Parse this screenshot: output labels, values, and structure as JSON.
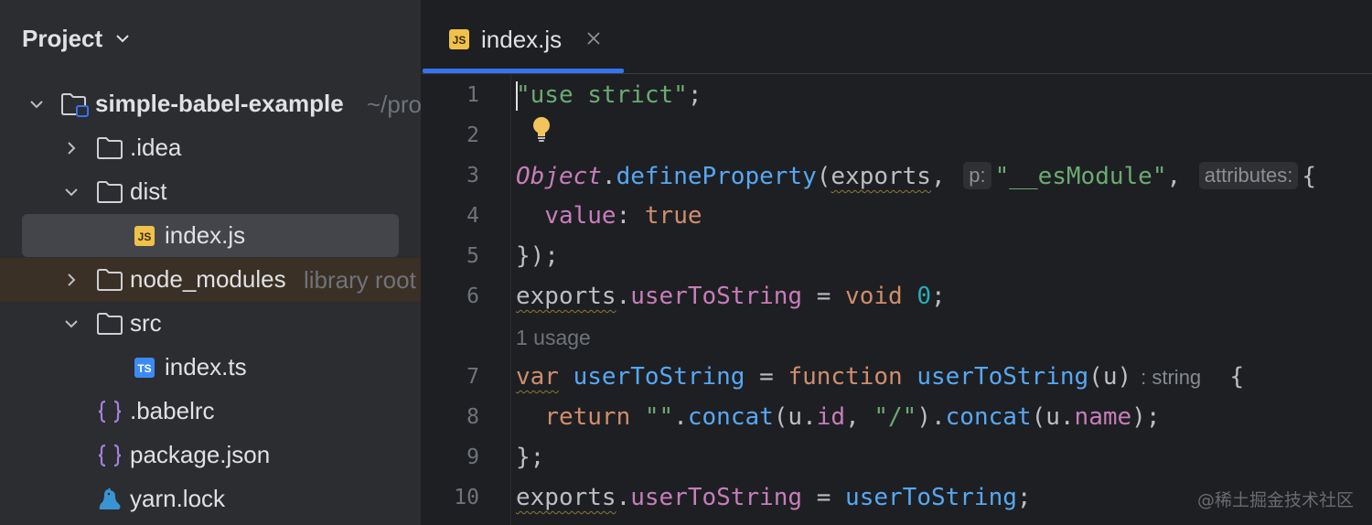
{
  "project_panel": {
    "title": "Project",
    "tree": [
      {
        "name": "simple-babel-example",
        "hint": "~/pro",
        "kind": "project-folder",
        "expanded": true
      },
      {
        "name": ".idea",
        "kind": "folder",
        "expanded": false
      },
      {
        "name": "dist",
        "kind": "folder",
        "expanded": true
      },
      {
        "name": "index.js",
        "kind": "js-file",
        "selected": true
      },
      {
        "name": "node_modules",
        "hint": "library root",
        "kind": "folder",
        "expanded": false
      },
      {
        "name": "src",
        "kind": "folder",
        "expanded": true
      },
      {
        "name": "index.ts",
        "kind": "ts-file"
      },
      {
        "name": ".babelrc",
        "kind": "json-file"
      },
      {
        "name": "package.json",
        "kind": "json-file"
      },
      {
        "name": "yarn.lock",
        "kind": "yarn-file"
      }
    ]
  },
  "editor": {
    "tab": {
      "label": "index.js",
      "icon": "js-file-icon",
      "active": true
    },
    "line_numbers": [
      "1",
      "2",
      "3",
      "4",
      "5",
      "6",
      "7",
      "8",
      "9",
      "10"
    ],
    "codelens_usage": "1 usage",
    "inlay_hints": {
      "p": "p:",
      "attributes": "attributes:",
      "return_type": ": string"
    },
    "lines": {
      "l1": {
        "string": "\"use strict\"",
        "end": ";"
      },
      "l3": {
        "obj": "Object",
        "dot": ".",
        "fn": "defineProperty",
        "open": "(",
        "arg1": "exports",
        "comma1": ",",
        "arg2": "\"__esModule\"",
        "comma2": ",",
        "brace": "{"
      },
      "l4": {
        "indent": "  ",
        "prop": "value",
        "colon": ": ",
        "val": "true"
      },
      "l5": {
        "text": "});"
      },
      "l6": {
        "ref": "exports",
        "dot": ".",
        "prop": "userToString",
        "eq": " = ",
        "kw": "void",
        "sp": " ",
        "num": "0",
        "end": ";"
      },
      "l7": {
        "kw": "var",
        "sp1": " ",
        "name": "userToString",
        "eq": " = ",
        "fnkw": "function",
        "sp2": " ",
        "fname": "userToString",
        "param": "(u)",
        "brace": "  {"
      },
      "l8": {
        "indent": "  ",
        "kw": "return",
        "sp": " ",
        "str1": "\"\"",
        "dot1": ".",
        "m1": "concat",
        "open1": "(u.",
        "id": "id",
        "comma": ", ",
        "str2": "\"/\"",
        "close1": ").",
        "m2": "concat",
        "open2": "(u.",
        "nameprop": "name",
        "close2": ");"
      },
      "l9": {
        "text": "};"
      },
      "l10": {
        "ref": "exports",
        "dot": ".",
        "prop": "userToString",
        "eq": " = ",
        "fn": "userToString",
        "end": ";"
      }
    }
  },
  "watermark": "@稀土掘金技术社区",
  "colors": {
    "keyword": "#cf8e6d",
    "string": "#6aab73",
    "function": "#56a8f5",
    "property": "#c77dbb",
    "number": "#2aacb8",
    "tab_underline": "#3574f0",
    "selection": "#43454a",
    "library_root_row": "#3a3025"
  }
}
